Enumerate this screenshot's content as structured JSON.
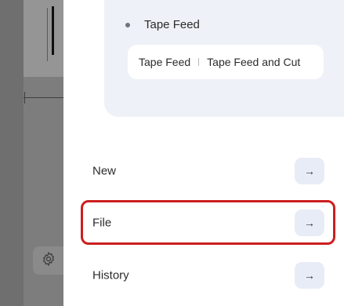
{
  "option_group": {
    "title": "Tape Feed",
    "segments": [
      "Tape Feed",
      "Tape Feed and Cut"
    ]
  },
  "menu": [
    {
      "label": "New",
      "arrow": "→"
    },
    {
      "label": "File",
      "arrow": "→"
    },
    {
      "label": "History",
      "arrow": "→"
    }
  ],
  "colors": {
    "highlight": "#cc1f1f",
    "option_card_bg": "#eef1f7",
    "row_button_bg": "#e7ecf6"
  },
  "icons": {
    "settings": "gear-icon",
    "arrow": "arrow-right-icon"
  }
}
